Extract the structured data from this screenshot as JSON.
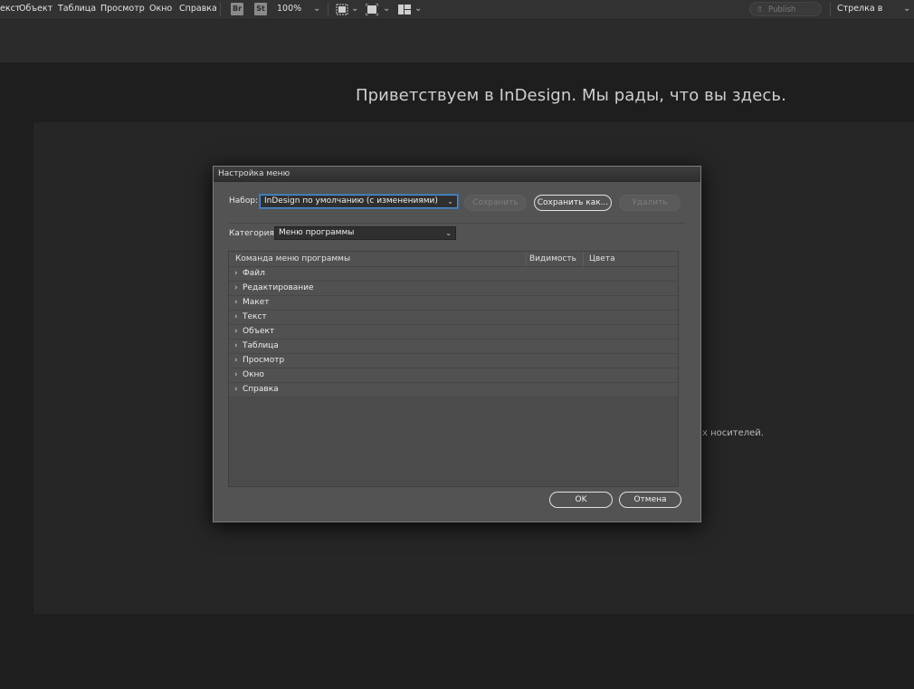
{
  "menubar": {
    "items": [
      "екст",
      "Объект",
      "Таблица",
      "Просмотр",
      "Окно",
      "Справка"
    ],
    "bridge_badge": "Br",
    "stock_badge": "St",
    "zoom": "100%",
    "publish_label": "Publish Online",
    "workspace": "Стрелка в начале"
  },
  "welcome": {
    "heading": "Приветствуем в InDesign. Мы рады, что вы здесь.",
    "partial_text": "х носителей."
  },
  "dialog": {
    "title": "Настройка меню",
    "set_label": "Набор:",
    "set_value": "InDesign по умолчанию (с изменениями)",
    "save_label": "Сохранить",
    "save_as_label": "Сохранить как...",
    "delete_label": "Удалить",
    "category_label": "Категория:",
    "category_value": "Меню программы",
    "columns": [
      "Команда меню программы",
      "Видимость",
      "Цвета"
    ],
    "rows": [
      "Файл",
      "Редактирование",
      "Макет",
      "Текст",
      "Объект",
      "Таблица",
      "Просмотр",
      "Окно",
      "Справка"
    ],
    "ok_label": "OK",
    "cancel_label": "Отмена"
  },
  "colors": {
    "menubar_bg": "#323232",
    "dialog_bg": "#535353",
    "focus_ring": "#4a8fd6"
  }
}
